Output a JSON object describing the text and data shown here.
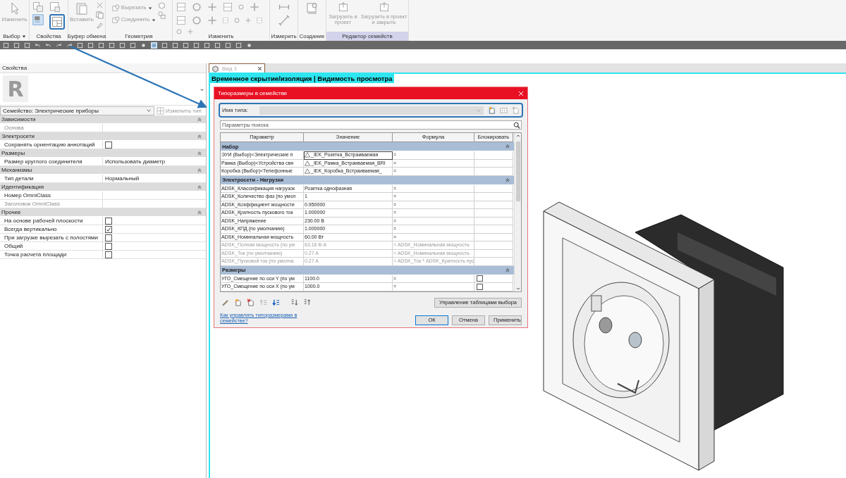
{
  "ribbon": {
    "groups": [
      {
        "label": "Выбор",
        "dropdown": true,
        "contextual": false,
        "buttons": [
          {
            "label": "Изменить",
            "disabled": true
          }
        ]
      },
      {
        "label": "Свойства",
        "dropdown": false,
        "contextual": false
      },
      {
        "label": "Буфер обмена",
        "dropdown": false,
        "contextual": false,
        "buttons": [
          {
            "label": "Вставить",
            "disabled": true
          }
        ]
      },
      {
        "label": "Геометрия",
        "dropdown": false,
        "contextual": false,
        "buttons": [
          {
            "label": "Вырезать",
            "disabled": true
          },
          {
            "label": "Соединить",
            "disabled": true
          }
        ]
      },
      {
        "label": "Изменить",
        "dropdown": false,
        "contextual": false
      },
      {
        "label": "Измерить",
        "dropdown": false,
        "contextual": false
      },
      {
        "label": "Создание",
        "dropdown": false,
        "contextual": false
      },
      {
        "label": "Редактор семейств",
        "dropdown": false,
        "contextual": true,
        "buttons": [
          {
            "label": "Загрузить в проект",
            "disabled": true
          },
          {
            "label": "Загрузить в проект и закрыть",
            "disabled": true
          }
        ]
      }
    ]
  },
  "properties": {
    "title": "Свойства",
    "preview_logo": "R",
    "type_selector": "Семейство: Электрические приборы",
    "edit_type_button": {
      "label": "Изменить тип",
      "disabled": true
    },
    "sections": [
      {
        "title": "Зависимости",
        "expanded": true,
        "rows": [
          {
            "label": "Основа",
            "kind": "text",
            "disabled": true
          }
        ]
      },
      {
        "title": "Электросети",
        "expanded": true,
        "rows": [
          {
            "label": "Сохранять ориентацию аннотаций",
            "kind": "checkbox",
            "checked": false,
            "disabled": false
          }
        ]
      },
      {
        "title": "Размеры",
        "expanded": true,
        "rows": [
          {
            "label": "Размер круглого соединителя",
            "kind": "text",
            "value": "Использовать диаметр",
            "disabled": false
          }
        ]
      },
      {
        "title": "Механизмы",
        "expanded": true,
        "rows": [
          {
            "label": "Тип детали",
            "kind": "text",
            "value": "Нормальный",
            "disabled": false
          }
        ]
      },
      {
        "title": "Идентификация",
        "expanded": true,
        "rows": [
          {
            "label": "Номер OmniClass",
            "kind": "text",
            "disabled": false
          },
          {
            "label": "Заголовок OmniClass",
            "kind": "text",
            "disabled": true
          }
        ]
      },
      {
        "title": "Прочее",
        "expanded": true,
        "rows": [
          {
            "label": "На основе рабочей плоскости",
            "kind": "checkbox",
            "checked": false,
            "disabled": false
          },
          {
            "label": "Всегда вертикально",
            "kind": "checkbox",
            "checked": true,
            "disabled": false
          },
          {
            "label": "При загрузке вырезать с полостями",
            "kind": "checkbox",
            "checked": false,
            "disabled": false
          },
          {
            "label": "Общий",
            "kind": "checkbox",
            "checked": false,
            "disabled": false
          },
          {
            "label": "Точка расчета площади",
            "kind": "checkbox",
            "checked": false,
            "disabled": false
          }
        ]
      }
    ]
  },
  "view": {
    "tab": "Вид 1",
    "banner": "Временное скрытие/изоляция | Видимость просмотра"
  },
  "dialog": {
    "title": "Типоразмеры в семействе",
    "type_name_label": "Имя типа:",
    "search_placeholder": "Параметры поиска",
    "columns": [
      "Параметр",
      "Значение",
      "Формула",
      "Блокировать"
    ],
    "groups": [
      {
        "title": "Набор",
        "expanded": true,
        "rows": [
          {
            "kind": "family_type",
            "parameter": "ЭУИ (Выбор)<Электрические п",
            "value": "_IEK_Розетка_Встраиваемая",
            "formula": "=",
            "disabled": false,
            "selected": true
          },
          {
            "kind": "family_type",
            "parameter": "Рамка (Выбор)<Устройства свя",
            "value": "_IEK_Рамка_Встраиваемая_BRI",
            "formula": "=",
            "disabled": false,
            "selected": false
          },
          {
            "kind": "family_type",
            "parameter": "Коробка (Выбор)<Телефонные",
            "value": "_IEK_Коробка_Встраиваемая_",
            "formula": "=",
            "disabled": false,
            "selected": false
          }
        ]
      },
      {
        "title": "Электросети - Нагрузки",
        "expanded": true,
        "rows": [
          {
            "kind": "plain",
            "parameter": "ADSK_Классификация нагрузок",
            "value": "Розетка однофазная",
            "formula": "=",
            "disabled": false,
            "selected": false
          },
          {
            "kind": "plain",
            "parameter": "ADSK_Количество фаз (по умол",
            "value": "1",
            "formula": "=",
            "disabled": false,
            "selected": false
          },
          {
            "kind": "plain",
            "parameter": "ADSK_Коэффициент мощности",
            "value": "0.950000",
            "formula": "=",
            "disabled": false,
            "selected": false
          },
          {
            "kind": "plain",
            "parameter": "ADSK_Кратность пускового ток",
            "value": "1.000000",
            "formula": "=",
            "disabled": false,
            "selected": false
          },
          {
            "kind": "plain",
            "parameter": "ADSK_Напряжение",
            "value": "230.00 В",
            "formula": "=",
            "disabled": false,
            "selected": false
          },
          {
            "kind": "plain",
            "parameter": "ADSK_КПД (по умолчанию)",
            "value": "1.000000",
            "formula": "=",
            "disabled": false,
            "selected": false
          },
          {
            "kind": "plain",
            "parameter": "ADSK_Номинальная мощность",
            "value": "60.00 Вт",
            "formula": "=",
            "disabled": false,
            "selected": false
          },
          {
            "kind": "plain",
            "parameter": "ADSK_Полная мощность (по ум",
            "value": "63.16 В·А",
            "formula": "= ADSK_Номинальная мощность",
            "disabled": true,
            "selected": false
          },
          {
            "kind": "plain",
            "parameter": "ADSK_Ток (по умолчанию)",
            "value": "0.27 A",
            "formula": "= ADSK_Номинальная мощность",
            "disabled": true,
            "selected": false
          },
          {
            "kind": "plain",
            "parameter": "ADSK_Пусковой ток (по умолча",
            "value": "0.27 A",
            "formula": "= ADSK_Ток * ADSK_Кратность пус",
            "disabled": true,
            "selected": false
          }
        ]
      },
      {
        "title": "Размеры",
        "expanded": true,
        "rows": [
          {
            "kind": "lockable",
            "parameter": "УГО_Смещение по оси Y (по ум",
            "value": "1100.0",
            "formula": "=",
            "disabled": false,
            "selected": false,
            "locked": false
          },
          {
            "kind": "lockable",
            "parameter": "УГО_Смещение по оси X (по ум",
            "value": "1000.0",
            "formula": "=",
            "disabled": false,
            "selected": false,
            "locked": false
          }
        ]
      }
    ],
    "manage_lookup_button": "Управление таблицами выбора",
    "help_link": "Как управлять типоразмерами в семействе?",
    "buttons": [
      "ОК",
      "Отмена",
      "Применить"
    ]
  }
}
